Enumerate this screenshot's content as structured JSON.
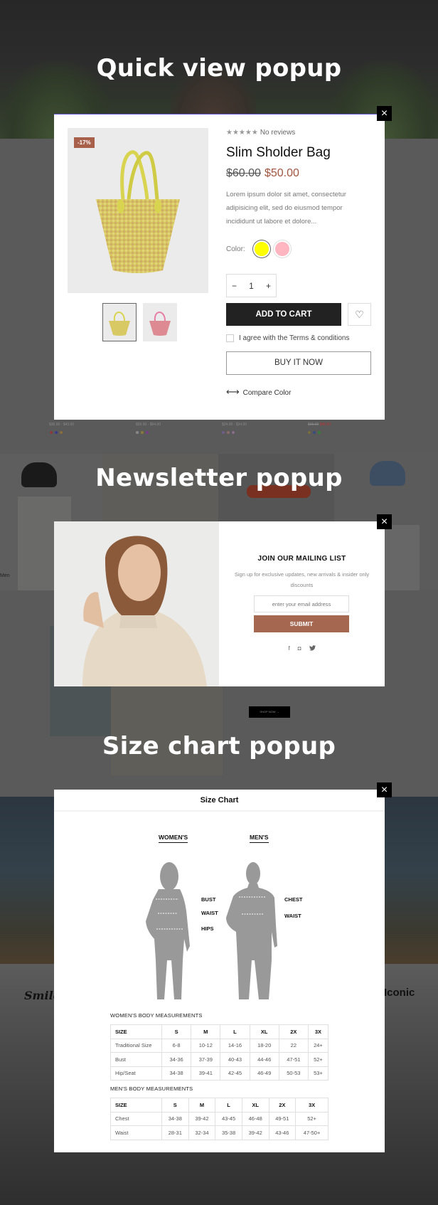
{
  "sections": {
    "quick_view_title": "Quick view popup",
    "newsletter_title": "Newsletter popup",
    "size_chart_title": "Size chart popup"
  },
  "background": {
    "product_prices": [
      "$36.00 - $43.00",
      "$56.00 - $64.00",
      "$24.00 - $34.00"
    ],
    "sale_price_old": "$65.00",
    "sale_price_new": "$45.00",
    "shop_now": "SHOP NOW →",
    "brand_left": "Smile",
    "brand_right": "Iconic",
    "cat_label": "Men"
  },
  "quick_view": {
    "close_icon": "×",
    "badge": "-17%",
    "rating_stars": "★★★★★",
    "rating_text": "No reviews",
    "title": "Slim Sholder Bag",
    "price_old": "$60.00",
    "price_new": "$50.00",
    "description": "Lorem ipsum dolor sit amet, consectetur adipisicing elit, sed do eiusmod tempor incididunt ut labore et dolore...",
    "color_label": "Color:",
    "colors": [
      {
        "name": "Yellow",
        "hex": "#ffff00",
        "selected": true
      },
      {
        "name": "Pink",
        "hex": "#ffb6c1",
        "selected": false
      }
    ],
    "qty_minus": "−",
    "qty_value": "1",
    "qty_plus": "+",
    "add_to_cart": "ADD TO CART",
    "wishlist_icon": "♡",
    "agree_text": "I agree with the Terms & conditions",
    "buy_now": "BUY IT NOW",
    "compare_icon": "⟷",
    "compare_text": "Compare Color"
  },
  "newsletter": {
    "close_icon": "×",
    "title": "JOIN OUR MAILING LIST",
    "subtitle": "Sign up for exclusive updates, new arrivals & insider only discounts",
    "email_placeholder": "enter your email address",
    "submit": "SUBMIT",
    "social": {
      "facebook": "f",
      "instagram": "◘",
      "twitter": "🐦"
    }
  },
  "size_chart": {
    "close_icon": "×",
    "title": "Size Chart",
    "womens_label": "WOMEN'S",
    "mens_label": "MEN'S",
    "womens_measure_labels": [
      "BUST",
      "WAIST",
      "HIPS"
    ],
    "mens_measure_labels": [
      "CHEST",
      "WAIST"
    ],
    "womens_table_title": "WOMEN'S BODY MEASUREMENTS",
    "mens_table_title": "MEN'S BODY MEASUREMENTS",
    "womens_table": [
      [
        "SIZE",
        "S",
        "M",
        "L",
        "XL",
        "2X",
        "3X"
      ],
      [
        "Traditional Size",
        "6-8",
        "10-12",
        "14-16",
        "18-20",
        "22",
        "24+"
      ],
      [
        "Bust",
        "34-36",
        "37-39",
        "40-43",
        "44-46",
        "47-51",
        "52+"
      ],
      [
        "Hip/Seat",
        "34-38",
        "39-41",
        "42-45",
        "46-49",
        "50-53",
        "53+"
      ]
    ],
    "mens_table": [
      [
        "SIZE",
        "S",
        "M",
        "L",
        "XL",
        "2X",
        "3X"
      ],
      [
        "Chest",
        "34-38",
        "39-42",
        "43-45",
        "46-48",
        "49-51",
        "52+"
      ],
      [
        "Waist",
        "28-31",
        "32-34",
        "35-38",
        "39-42",
        "43-46",
        "47-50+"
      ]
    ]
  }
}
